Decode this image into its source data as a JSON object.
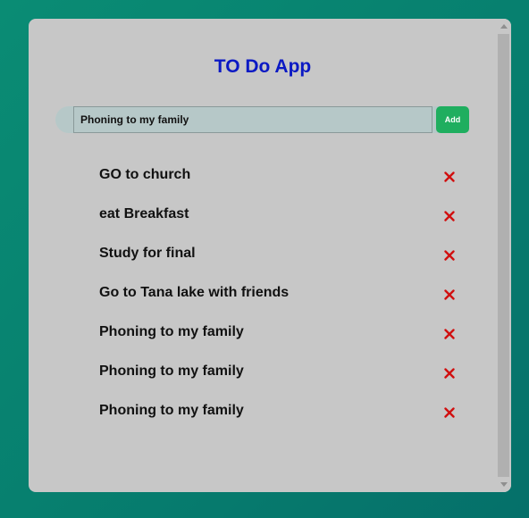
{
  "app": {
    "title": "TO Do App"
  },
  "input": {
    "value": "Phoning to my family",
    "placeholder": ""
  },
  "add_button": {
    "label": "Add"
  },
  "todos": [
    {
      "text": "GO to church",
      "delete_icon": "close-icon"
    },
    {
      "text": "eat Breakfast",
      "delete_icon": "close-icon"
    },
    {
      "text": "Study for final",
      "delete_icon": "close-icon"
    },
    {
      "text": "Go to Tana lake with friends",
      "delete_icon": "close-icon"
    },
    {
      "text": "Phoning to my family",
      "delete_icon": "close-icon"
    },
    {
      "text": "Phoning to my family",
      "delete_icon": "close-icon"
    },
    {
      "text": "Phoning to my family",
      "delete_icon": "close-icon"
    }
  ],
  "colors": {
    "background": "#0a8c74",
    "card": "#c7c7c7",
    "title": "#0b19c4",
    "add_button": "#1fae5f",
    "delete_icon": "#d10f0f",
    "input_bg": "#b6c8c8"
  }
}
